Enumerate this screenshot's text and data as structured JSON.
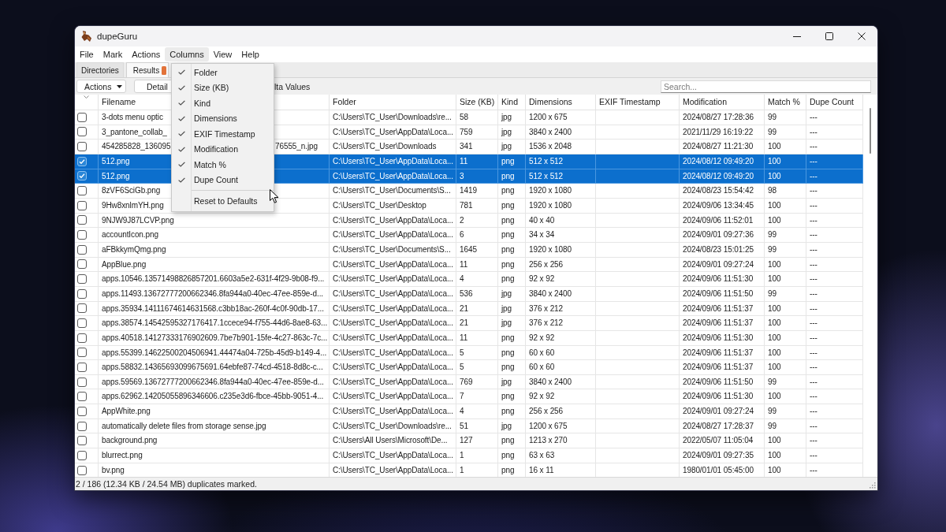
{
  "window": {
    "title": "dupeGuru"
  },
  "menu_bar": [
    {
      "label": "File",
      "selected": false
    },
    {
      "label": "Mark",
      "selected": false
    },
    {
      "label": "Actions",
      "selected": false
    },
    {
      "label": "Columns",
      "selected": true
    },
    {
      "label": "View",
      "selected": false
    },
    {
      "label": "Help",
      "selected": false
    }
  ],
  "columns_menu": {
    "items": [
      {
        "kind": "check",
        "label": "Folder",
        "checked": true
      },
      {
        "kind": "check",
        "label": "Size (KB)",
        "checked": true
      },
      {
        "kind": "check",
        "label": "Kind",
        "checked": true
      },
      {
        "kind": "check",
        "label": "Dimensions",
        "checked": true
      },
      {
        "kind": "check",
        "label": "EXIF Timestamp",
        "checked": true
      },
      {
        "kind": "check",
        "label": "Modification",
        "checked": true
      },
      {
        "kind": "check",
        "label": "Match %",
        "checked": true
      },
      {
        "kind": "check",
        "label": "Dupe Count",
        "checked": true
      },
      {
        "kind": "separator"
      },
      {
        "kind": "action",
        "label": "Reset to Defaults"
      }
    ]
  },
  "tabs": [
    {
      "label": "Directories",
      "selected": false
    },
    {
      "label": "Results",
      "selected": true
    }
  ],
  "toolbar": {
    "actions_button": "Actions",
    "details_button": "Detail",
    "option_label": "lta Values",
    "search": {
      "placeholder": "Search..."
    }
  },
  "table": {
    "columns": [
      "Filename",
      "Folder",
      "Size (KB)",
      "Kind",
      "Dimensions",
      "EXIF Timestamp",
      "Modification",
      "Match %",
      "Dupe Count"
    ],
    "rows": [
      {
        "checked": false,
        "selected": false,
        "filename": "3-dots menu optic",
        "folder": "C:\\Users\\TC_User\\Downloads\\re...",
        "size": "58",
        "kind": "jpg",
        "dimensions": "1200 x 675",
        "modification": "2024/08/27 17:28:36",
        "match": "99",
        "dupe_count": "---"
      },
      {
        "checked": false,
        "selected": false,
        "filename": "3_pantone_collab_",
        "folder": "C:\\Users\\TC_User\\AppData\\Loca...",
        "size": "759",
        "kind": "jpg",
        "dimensions": "3840 x 2400",
        "modification": "2021/11/29 16:19:22",
        "match": "99",
        "dupe_count": "---"
      },
      {
        "checked": false,
        "selected": false,
        "filename": "454285828_136095",
        "filename_tail": "76555_n.jpg",
        "folder": "C:\\Users\\TC_User\\Downloads",
        "size": "341",
        "kind": "jpg",
        "dimensions": "1536 x 2048",
        "modification": "2024/08/27 11:21:30",
        "match": "100",
        "dupe_count": "---"
      },
      {
        "checked": true,
        "selected": true,
        "filename": "512.png",
        "folder": "C:\\Users\\TC_User\\AppData\\Loca...",
        "size": "11",
        "kind": "png",
        "dimensions": "512 x 512",
        "modification": "2024/08/12 09:49:20",
        "match": "100",
        "dupe_count": "---"
      },
      {
        "checked": true,
        "selected": true,
        "filename": "512.png",
        "folder": "C:\\Users\\TC_User\\AppData\\Loca...",
        "size": "3",
        "kind": "png",
        "dimensions": "512 x 512",
        "modification": "2024/08/12 09:49:20",
        "match": "100",
        "dupe_count": "---"
      },
      {
        "checked": false,
        "selected": false,
        "filename": "8zVF6SciGb.png",
        "folder": "C:\\Users\\TC_User\\Documents\\S...",
        "size": "1419",
        "kind": "png",
        "dimensions": "1920 x 1080",
        "modification": "2024/08/23 15:54:42",
        "match": "98",
        "dupe_count": "---"
      },
      {
        "checked": false,
        "selected": false,
        "filename": "9Hw8xnlmYH.png",
        "folder": "C:\\Users\\TC_User\\Desktop",
        "size": "781",
        "kind": "png",
        "dimensions": "1920 x 1080",
        "modification": "2024/09/06 13:34:45",
        "match": "100",
        "dupe_count": "---"
      },
      {
        "checked": false,
        "selected": false,
        "filename": "9NJW9J87LCVP.png",
        "folder": "C:\\Users\\TC_User\\AppData\\Loca...",
        "size": "2",
        "kind": "png",
        "dimensions": "40 x 40",
        "modification": "2024/09/06 11:52:01",
        "match": "100",
        "dupe_count": "---"
      },
      {
        "checked": false,
        "selected": false,
        "filename": "accountIcon.png",
        "folder": "C:\\Users\\TC_User\\AppData\\Loca...",
        "size": "6",
        "kind": "png",
        "dimensions": "34 x 34",
        "modification": "2024/09/01 09:27:36",
        "match": "99",
        "dupe_count": "---"
      },
      {
        "checked": false,
        "selected": false,
        "filename": "aFBkkymQmg.png",
        "folder": "C:\\Users\\TC_User\\Documents\\S...",
        "size": "1645",
        "kind": "png",
        "dimensions": "1920 x 1080",
        "modification": "2024/08/23 15:01:25",
        "match": "99",
        "dupe_count": "---"
      },
      {
        "checked": false,
        "selected": false,
        "filename": "AppBlue.png",
        "folder": "C:\\Users\\TC_User\\AppData\\Loca...",
        "size": "11",
        "kind": "png",
        "dimensions": "256 x 256",
        "modification": "2024/09/01 09:27:24",
        "match": "100",
        "dupe_count": "---"
      },
      {
        "checked": false,
        "selected": false,
        "filename": "apps.10546.13571498826857201.6603a5e2-631f-4f29-9b08-f9...",
        "folder": "C:\\Users\\TC_User\\AppData\\Loca...",
        "size": "4",
        "kind": "png",
        "dimensions": "92 x 92",
        "modification": "2024/09/06 11:51:30",
        "match": "100",
        "dupe_count": "---"
      },
      {
        "checked": false,
        "selected": false,
        "filename": "apps.11493.13672777200662346.8fa944a0-40ec-47ee-859e-d...",
        "folder": "C:\\Users\\TC_User\\AppData\\Loca...",
        "size": "536",
        "kind": "jpg",
        "dimensions": "3840 x 2400",
        "modification": "2024/09/06 11:51:50",
        "match": "99",
        "dupe_count": "---"
      },
      {
        "checked": false,
        "selected": false,
        "filename": "apps.35934.14111674614631568.c3bb18ac-260f-4c0f-90db-17...",
        "folder": "C:\\Users\\TC_User\\AppData\\Loca...",
        "size": "21",
        "kind": "jpg",
        "dimensions": "376 x 212",
        "modification": "2024/09/06 11:51:37",
        "match": "100",
        "dupe_count": "---"
      },
      {
        "checked": false,
        "selected": false,
        "filename": "apps.38574.14542595327176417.1ccece94-f755-44d6-8ae8-63...",
        "folder": "C:\\Users\\TC_User\\AppData\\Loca...",
        "size": "21",
        "kind": "jpg",
        "dimensions": "376 x 212",
        "modification": "2024/09/06 11:51:37",
        "match": "100",
        "dupe_count": "---"
      },
      {
        "checked": false,
        "selected": false,
        "filename": "apps.40518.14127333176902609.7be7b901-15fe-4c27-863c-7c...",
        "folder": "C:\\Users\\TC_User\\AppData\\Loca...",
        "size": "11",
        "kind": "png",
        "dimensions": "92 x 92",
        "modification": "2024/09/06 11:51:30",
        "match": "100",
        "dupe_count": "---"
      },
      {
        "checked": false,
        "selected": false,
        "filename": "apps.55399.14622500204506941.44474a04-725b-45d9-b149-4...",
        "folder": "C:\\Users\\TC_User\\AppData\\Loca...",
        "size": "5",
        "kind": "png",
        "dimensions": "60 x 60",
        "modification": "2024/09/06 11:51:37",
        "match": "100",
        "dupe_count": "---"
      },
      {
        "checked": false,
        "selected": false,
        "filename": "apps.58832.14365693099675691.64ebfe87-74cd-4518-8d8c-c...",
        "folder": "C:\\Users\\TC_User\\AppData\\Loca...",
        "size": "5",
        "kind": "png",
        "dimensions": "60 x 60",
        "modification": "2024/09/06 11:51:37",
        "match": "100",
        "dupe_count": "---"
      },
      {
        "checked": false,
        "selected": false,
        "filename": "apps.59569.13672777200662346.8fa944a0-40ec-47ee-859e-d...",
        "folder": "C:\\Users\\TC_User\\AppData\\Loca...",
        "size": "769",
        "kind": "jpg",
        "dimensions": "3840 x 2400",
        "modification": "2024/09/06 11:51:50",
        "match": "99",
        "dupe_count": "---"
      },
      {
        "checked": false,
        "selected": false,
        "filename": "apps.62962.14205055896346606.c235e3d6-fbce-45bb-9051-4...",
        "folder": "C:\\Users\\TC_User\\AppData\\Loca...",
        "size": "7",
        "kind": "png",
        "dimensions": "92 x 92",
        "modification": "2024/09/06 11:51:30",
        "match": "100",
        "dupe_count": "---"
      },
      {
        "checked": false,
        "selected": false,
        "filename": "AppWhite.png",
        "folder": "C:\\Users\\TC_User\\AppData\\Loca...",
        "size": "4",
        "kind": "png",
        "dimensions": "256 x 256",
        "modification": "2024/09/01 09:27:24",
        "match": "99",
        "dupe_count": "---"
      },
      {
        "checked": false,
        "selected": false,
        "filename": "automatically delete files from storage sense.jpg",
        "folder": "C:\\Users\\TC_User\\Downloads\\re...",
        "size": "51",
        "kind": "jpg",
        "dimensions": "1200 x 675",
        "modification": "2024/08/27 17:28:37",
        "match": "99",
        "dupe_count": "---"
      },
      {
        "checked": false,
        "selected": false,
        "filename": "background.png",
        "folder": "C:\\Users\\All Users\\Microsoft\\De...",
        "size": "127",
        "kind": "png",
        "dimensions": "1213 x 270",
        "modification": "2022/05/07 11:05:04",
        "match": "100",
        "dupe_count": "---"
      },
      {
        "checked": false,
        "selected": false,
        "filename": "blurrect.png",
        "folder": "C:\\Users\\TC_User\\AppData\\Loca...",
        "size": "1",
        "kind": "png",
        "dimensions": "63 x 63",
        "modification": "2024/09/01 09:27:35",
        "match": "100",
        "dupe_count": "---"
      },
      {
        "checked": false,
        "selected": false,
        "filename": "bv.png",
        "folder": "C:\\Users\\TC_User\\AppData\\Loca...",
        "size": "1",
        "kind": "png",
        "dimensions": "16 x 11",
        "modification": "1980/01/01 05:45:00",
        "match": "100",
        "dupe_count": "---"
      }
    ]
  },
  "status_bar": {
    "text": "2 / 186 (12.34 KB / 24.54 MB) duplicates marked."
  }
}
